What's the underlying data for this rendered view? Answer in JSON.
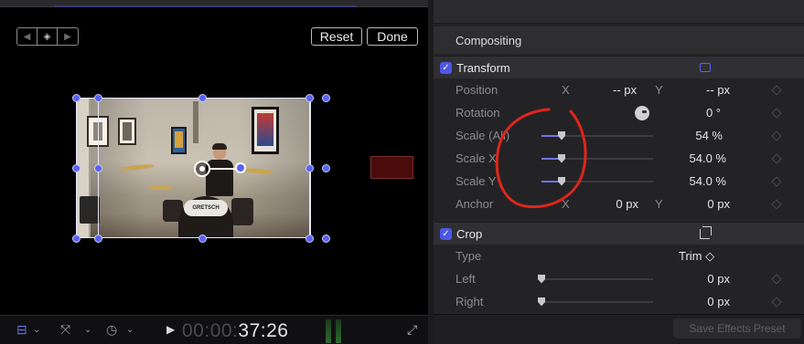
{
  "viewer": {
    "keyframe_nav": {
      "prev_icon": "arrow-left-icon",
      "add_icon": "keyframe-diamond-icon",
      "next_icon": "arrow-right-icon"
    },
    "reset_label": "Reset",
    "done_label": "Done",
    "frame": {
      "bass_drum_text": "GRETSCH"
    },
    "bottom_bar": {
      "view_icon": "view-options-icon",
      "transform_icon": "transform-tools-icon",
      "speed_icon": "retime-icon",
      "play_icon": "play-icon",
      "timecode_dim": "00:00:",
      "timecode_lit": "37:26",
      "fullscreen_icon": "fullscreen-icon"
    }
  },
  "inspector": {
    "compositing_label": "Compositing",
    "transform": {
      "label": "Transform",
      "enabled": true,
      "position": {
        "label": "Position",
        "x_axis": "X",
        "x_value": "-- px",
        "y_axis": "Y",
        "y_value": "-- px"
      },
      "rotation": {
        "label": "Rotation",
        "value": "0 °"
      },
      "scale_all": {
        "label": "Scale (All)",
        "value": "54 %",
        "slider_fraction": 0.18
      },
      "scale_x": {
        "label": "Scale X",
        "value": "54.0 %",
        "slider_fraction": 0.18
      },
      "scale_y": {
        "label": "Scale Y",
        "value": "54.0 %",
        "slider_fraction": 0.18
      },
      "anchor": {
        "label": "Anchor",
        "x_axis": "X",
        "x_value": "0 px",
        "y_axis": "Y",
        "y_value": "0 px"
      }
    },
    "crop": {
      "label": "Crop",
      "enabled": true,
      "type": {
        "label": "Type",
        "value": "Trim ◇"
      },
      "left": {
        "label": "Left",
        "value": "0 px",
        "slider_fraction": 0.0
      },
      "right": {
        "label": "Right",
        "value": "0 px",
        "slider_fraction": 0.0
      }
    },
    "save_preset_label": "Save Effects Preset"
  },
  "colors": {
    "accent": "#5a63f2",
    "annotation": "#e0261c"
  }
}
